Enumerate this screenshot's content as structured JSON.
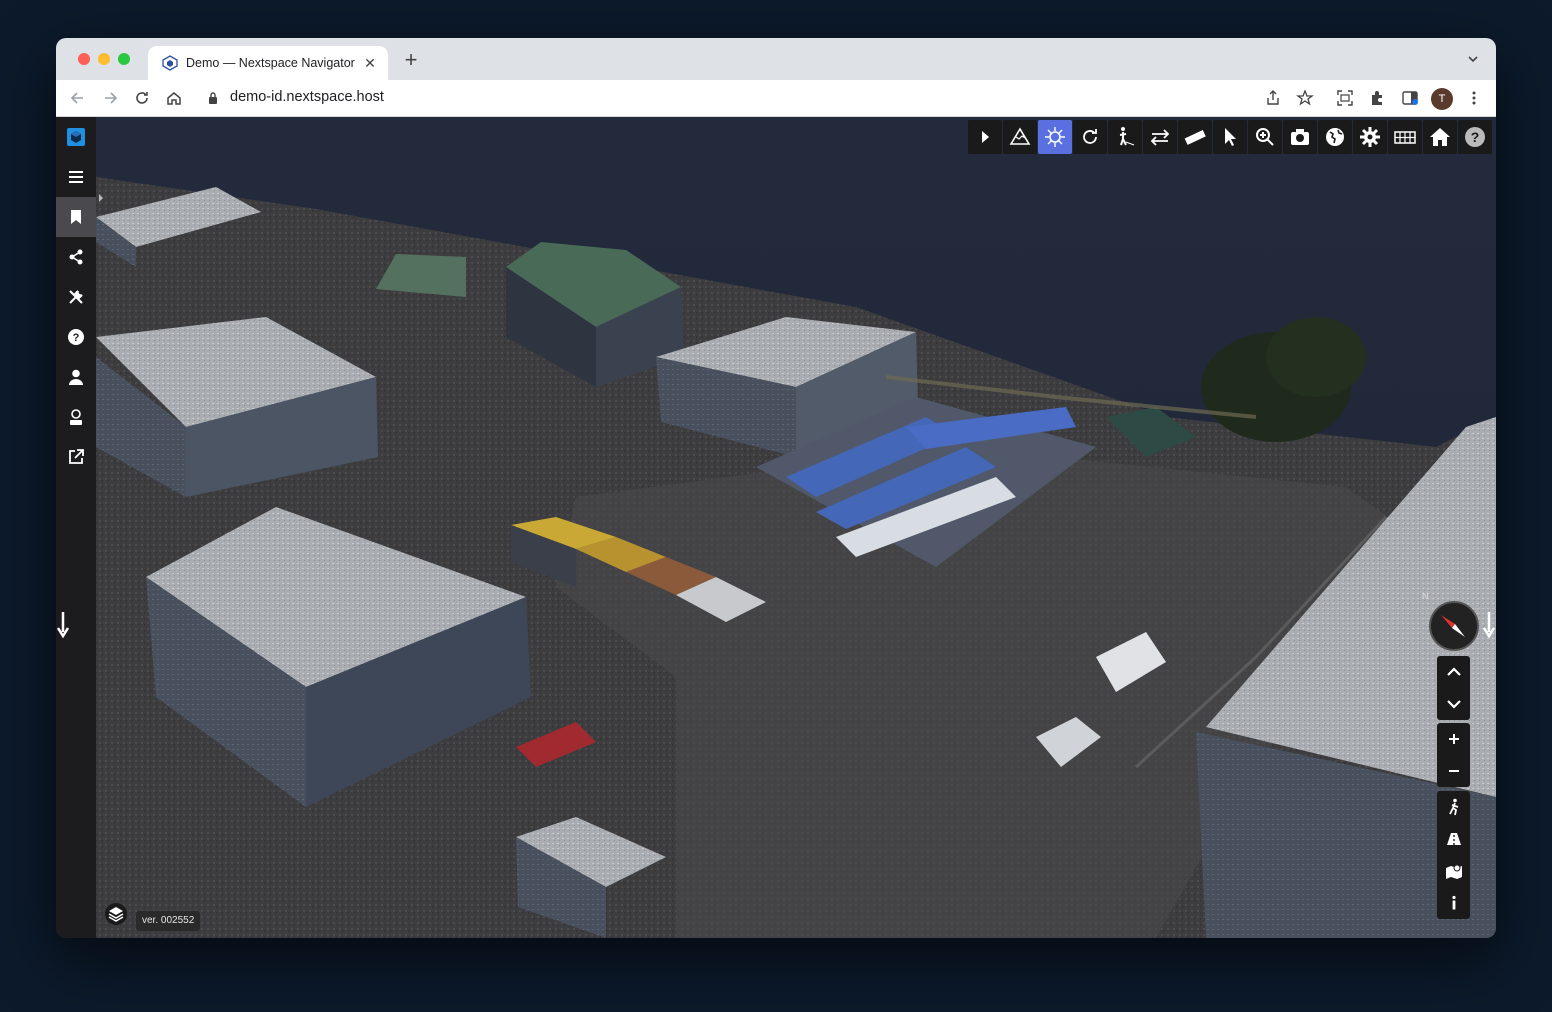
{
  "browser": {
    "tab": {
      "title": "Demo — Nextspace Navigator",
      "close_glyph": "✕"
    },
    "new_tab_glyph": "+",
    "address_bar": {
      "url": "demo-id.nextspace.host"
    },
    "profile": {
      "initial": "T"
    }
  },
  "sidebar": {
    "items": [
      {
        "name": "logo-cube-icon"
      },
      {
        "name": "menu-icon"
      },
      {
        "name": "bookmark-icon",
        "active": true
      },
      {
        "name": "share-icon"
      },
      {
        "name": "tools-icon"
      },
      {
        "name": "help-icon"
      },
      {
        "name": "user-icon"
      },
      {
        "name": "viewer-icon"
      },
      {
        "name": "external-link-icon"
      }
    ]
  },
  "viewer_toolbar": {
    "tools": [
      {
        "name": "play-icon"
      },
      {
        "name": "terrain-icon"
      },
      {
        "name": "lighting-icon",
        "active": true
      },
      {
        "name": "rotate-icon"
      },
      {
        "name": "walk-icon"
      },
      {
        "name": "swap-icon"
      },
      {
        "name": "measure-ruler-icon"
      },
      {
        "name": "select-cursor-icon"
      },
      {
        "name": "zoom-icon"
      },
      {
        "name": "camera-icon"
      },
      {
        "name": "globe-icon"
      },
      {
        "name": "settings-icon"
      },
      {
        "name": "grid-icon"
      },
      {
        "name": "home-icon"
      },
      {
        "name": "help-icon"
      }
    ]
  },
  "navigation": {
    "compass_label": "N",
    "buttons": [
      "up",
      "down",
      "zoom-in",
      "zoom-out",
      "walk",
      "road",
      "map",
      "info"
    ]
  },
  "footer": {
    "version": "ver. 002552"
  },
  "colors": {
    "sidebar_bg": "#1c1c1e",
    "sidebar_active": "#4a4a4e",
    "tool_active": "#5a6fe0",
    "accent_cube": "#1f8fe0"
  }
}
